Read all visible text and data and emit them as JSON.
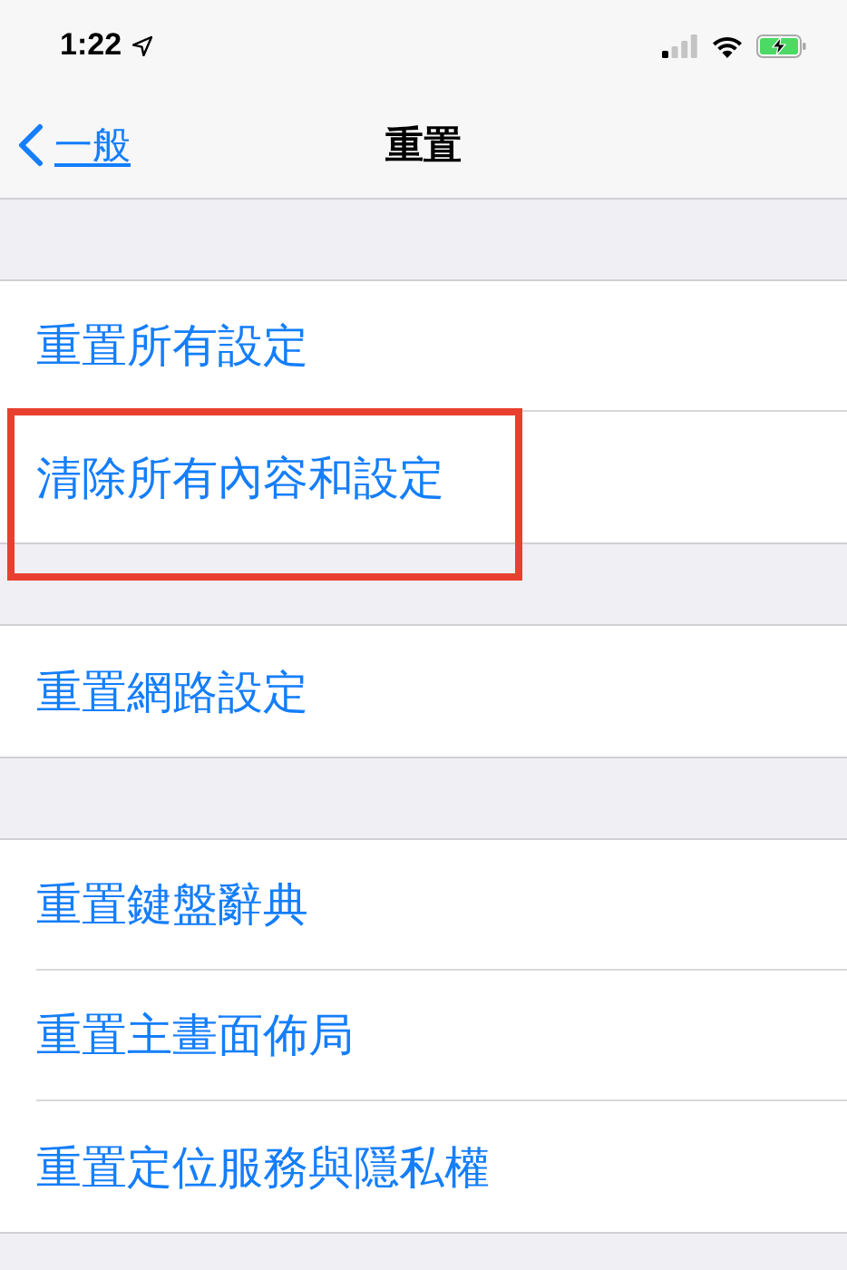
{
  "status_bar": {
    "time": "1:22",
    "location_services": true,
    "charging": true
  },
  "nav": {
    "back": "一般",
    "title": "重置"
  },
  "groups": [
    {
      "rows": [
        {
          "label": "重置所有設定",
          "highlighted": false
        },
        {
          "label": "清除所有內容和設定",
          "highlighted": true
        }
      ]
    },
    {
      "rows": [
        {
          "label": "重置網路設定",
          "highlighted": false
        }
      ]
    },
    {
      "rows": [
        {
          "label": "重置鍵盤辭典",
          "highlighted": false
        },
        {
          "label": "重置主畫面佈局",
          "highlighted": false
        },
        {
          "label": "重置定位服務與隱私權",
          "highlighted": false
        }
      ]
    }
  ]
}
